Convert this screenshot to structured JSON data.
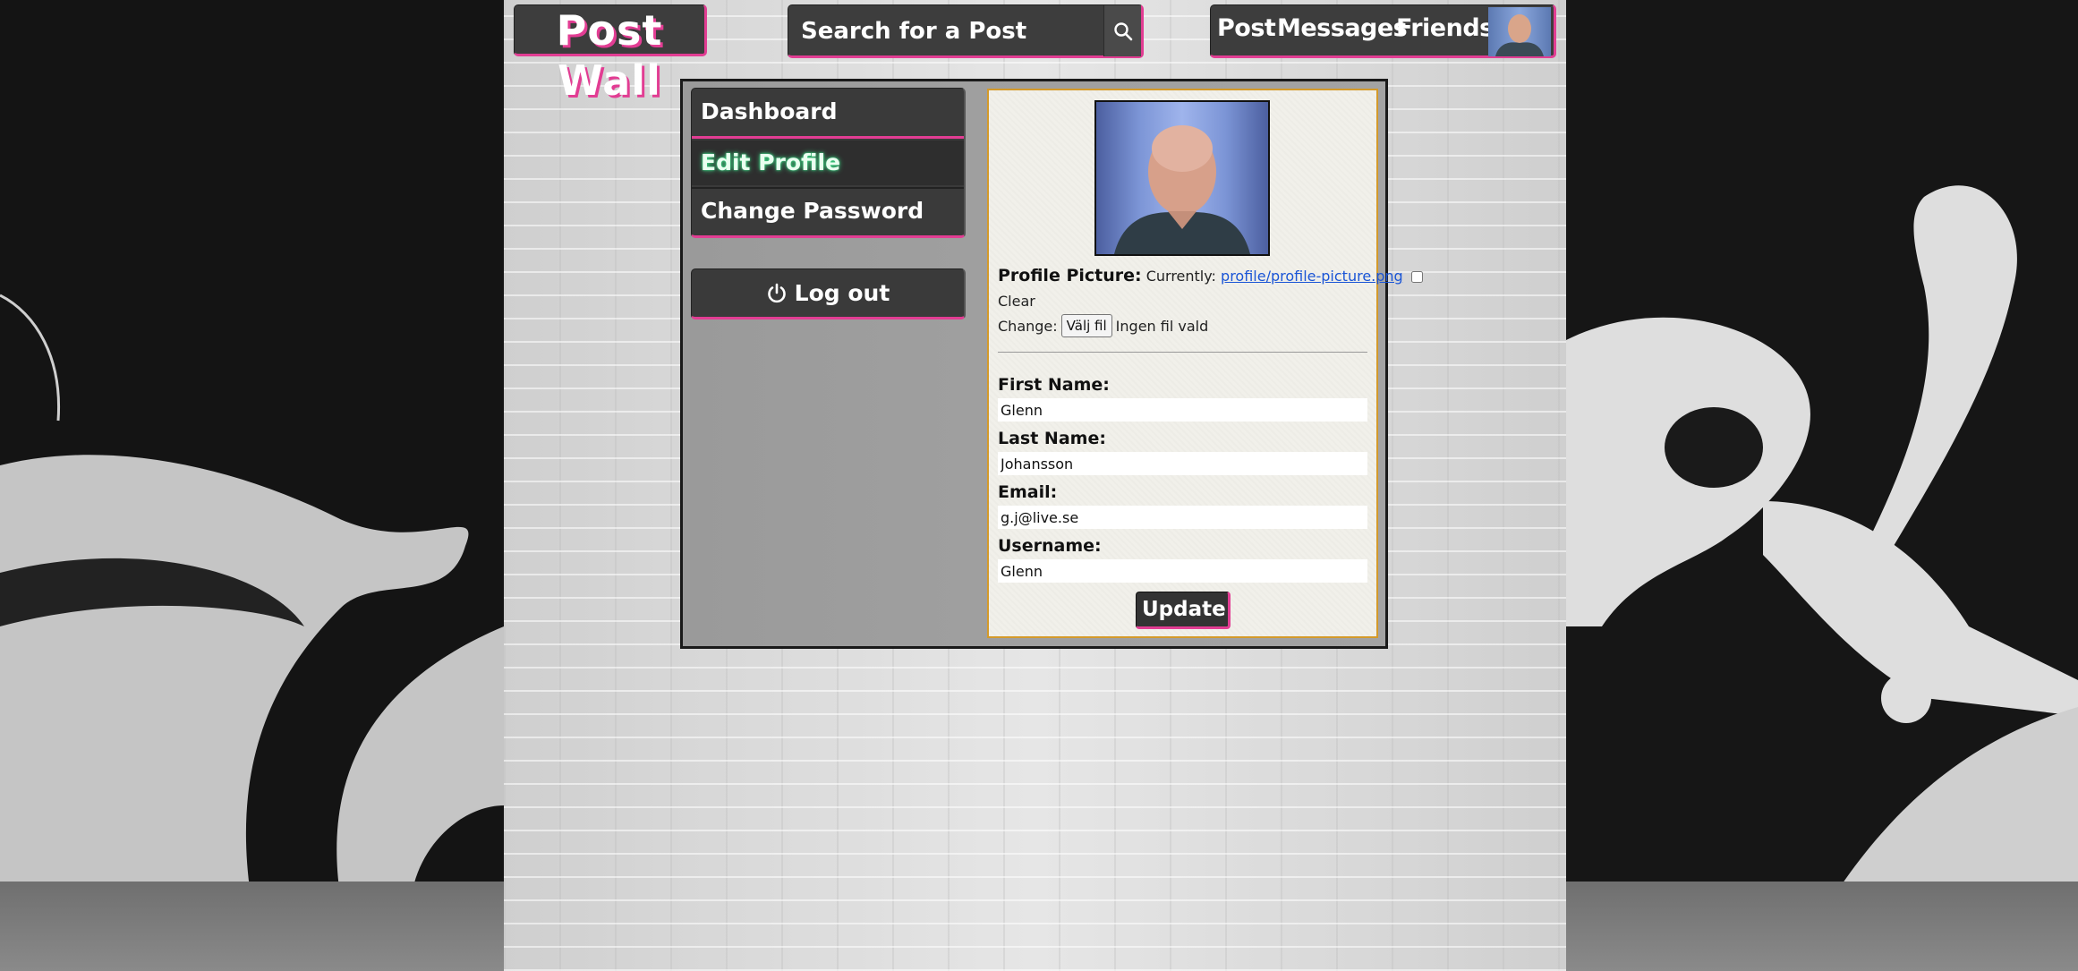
{
  "header": {
    "logo": "Post Wall",
    "search_placeholder": "Search for a Post",
    "nav": {
      "post": "Post",
      "messages": "Messages",
      "friends": "Friends"
    }
  },
  "sidebar": {
    "items": [
      {
        "label": "Dashboard"
      },
      {
        "label": "Edit Profile"
      },
      {
        "label": "Change Password"
      }
    ],
    "logout_label": "Log out"
  },
  "profile_form": {
    "picture_label": "Profile Picture:",
    "currently_label": "Currently:",
    "current_file": "profile/profile-picture.png",
    "clear_label": "Clear",
    "change_label": "Change:",
    "file_button_label": "Välj fil",
    "no_file_text": "Ingen fil vald",
    "fields": [
      {
        "label": "First Name:",
        "value": "Glenn"
      },
      {
        "label": "Last Name:",
        "value": "Johansson"
      },
      {
        "label": "Email:",
        "value": "g.j@live.se"
      },
      {
        "label": "Username:",
        "value": "Glenn"
      }
    ],
    "submit_label": "Update"
  },
  "colors": {
    "accent": "#e23d93",
    "panel": "#3a3a3a",
    "active_glow": "#3fe08a",
    "card_border": "#d49a2a",
    "link": "#1a55d6"
  },
  "icons": {
    "search": "magnifier",
    "logout": "power"
  }
}
